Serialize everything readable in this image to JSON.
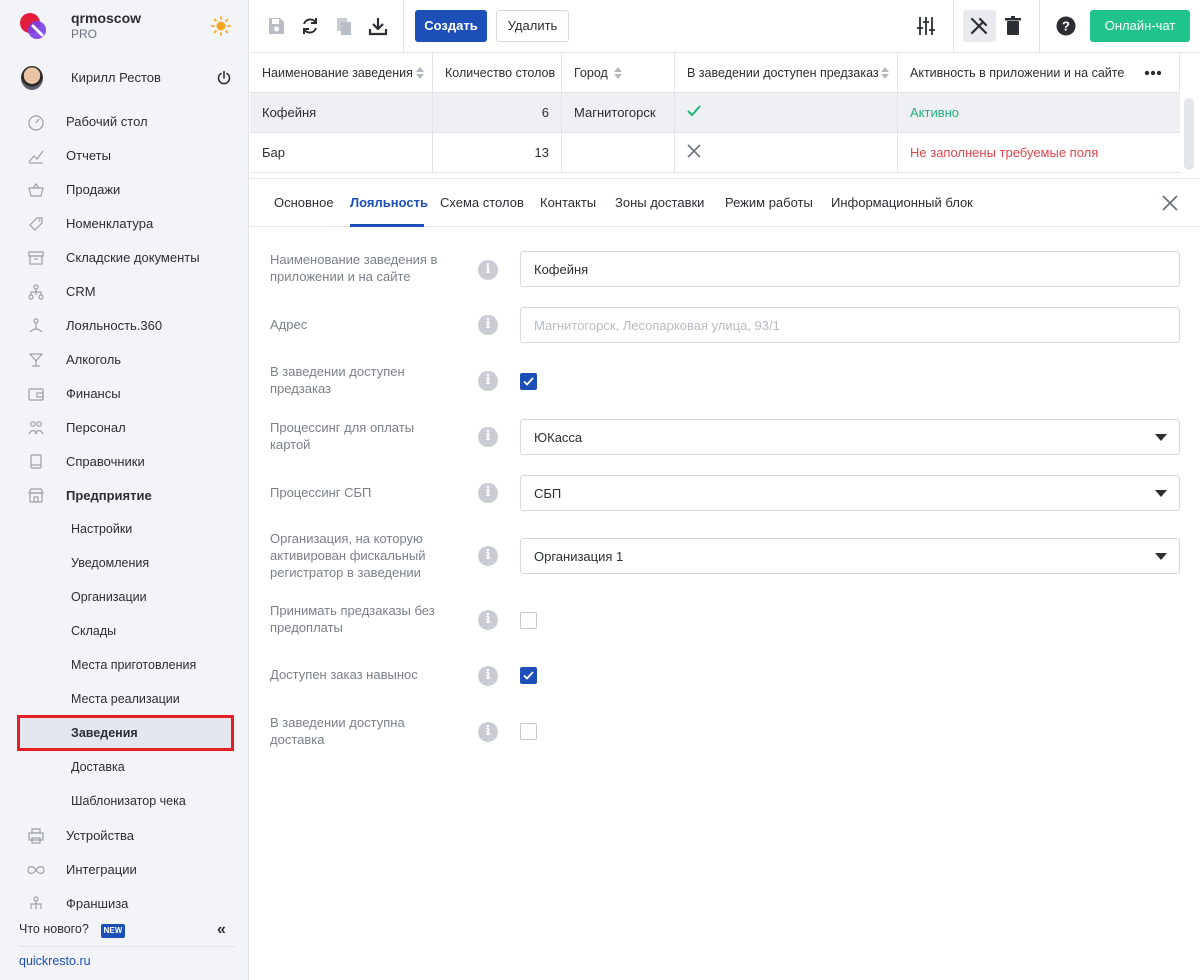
{
  "brand": {
    "name": "qrmoscow",
    "plan": "PRO"
  },
  "user": {
    "name": "Кирилл Рестов"
  },
  "nav": {
    "items": [
      {
        "label": "Рабочий стол",
        "icon": "dashboard-icon"
      },
      {
        "label": "Отчеты",
        "icon": "chart-icon"
      },
      {
        "label": "Продажи",
        "icon": "basket-icon"
      },
      {
        "label": "Номенклатура",
        "icon": "tag-icon"
      },
      {
        "label": "Складские документы",
        "icon": "archive-icon"
      },
      {
        "label": "CRM",
        "icon": "hierarchy-icon"
      },
      {
        "label": "Лояльность.360",
        "icon": "loyalty-icon"
      },
      {
        "label": "Алкоголь",
        "icon": "glass-icon"
      },
      {
        "label": "Финансы",
        "icon": "wallet-icon"
      },
      {
        "label": "Персонал",
        "icon": "people-icon"
      },
      {
        "label": "Справочники",
        "icon": "book-icon"
      },
      {
        "label": "Предприятие",
        "icon": "store-icon"
      }
    ],
    "sub_items": [
      "Настройки",
      "Уведомления",
      "Организации",
      "Склады",
      "Места приготовления",
      "Места реализации",
      "Заведения",
      "Доставка",
      "Шаблонизатор чека"
    ],
    "active_sub": "Заведения",
    "bottom_items": [
      {
        "label": "Устройства",
        "icon": "printer-icon"
      },
      {
        "label": "Интеграции",
        "icon": "infinity-icon"
      },
      {
        "label": "Франшиза",
        "icon": "franchise-icon"
      }
    ]
  },
  "sidebar_footer": {
    "whats_new": "Что нового?",
    "badge": "NEW",
    "site": "quickresto.ru"
  },
  "toolbar": {
    "create": "Создать",
    "delete": "Удалить",
    "chat": "Онлайн-чат"
  },
  "table": {
    "columns": [
      "Наименование заведения",
      "Количество столов",
      "Город",
      "В заведении доступен предзаказ",
      "Активность в приложении и на сайте"
    ],
    "rows": [
      {
        "name": "Кофейня",
        "tables": "6",
        "city": "Магнитогорск",
        "preorder": true,
        "status": "Активно",
        "status_color": "#1fb47a"
      },
      {
        "name": "Бар",
        "tables": "13",
        "city": "",
        "preorder": false,
        "status": "Не заполнены требуемые поля",
        "status_color": "#e0454b"
      }
    ]
  },
  "tabs": [
    "Основное",
    "Лояльность",
    "Схема столов",
    "Контакты",
    "Зоны доставки",
    "Режим работы",
    "Информационный блок"
  ],
  "active_tab": "Лояльность",
  "form": {
    "name_label": "Наименование заведения в приложении и на сайте",
    "name_value": "Кофейня",
    "address_label": "Адрес",
    "address_placeholder": "Магнитогорск, Лесопарковая улица, 93/1",
    "preorder_label": "В заведении доступен предзаказ",
    "preorder_checked": true,
    "card_processing_label": "Процессинг для оплаты картой",
    "card_processing_value": "ЮКасса",
    "sbp_label": "Процессинг СБП",
    "sbp_value": "СБП",
    "org_label": "Организация, на которую активирован фискальный регистратор в заведении",
    "org_value": "Организация 1",
    "no_prepay_label": "Принимать предзаказы без предоплаты",
    "no_prepay_checked": false,
    "takeaway_label": "Доступен заказ навынос",
    "takeaway_checked": true,
    "delivery_label": "В заведении доступна доставка",
    "delivery_checked": false
  },
  "colors": {
    "accent": "#1d4fb8",
    "chat": "#1fc48b",
    "highlight": "#e31e24"
  }
}
